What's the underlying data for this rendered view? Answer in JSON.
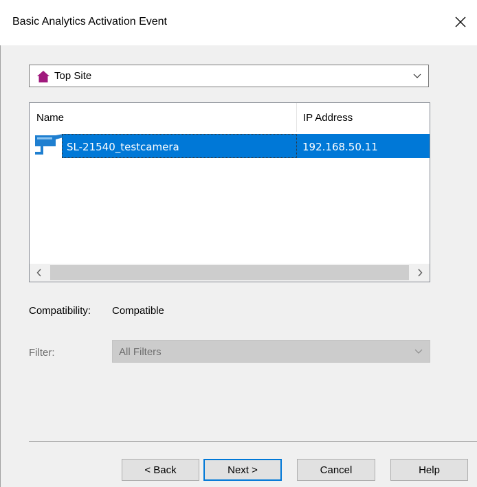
{
  "window": {
    "title": "Basic Analytics Activation Event",
    "close_icon": "close-icon"
  },
  "site_select": {
    "value": "Top Site",
    "icon": "home-icon",
    "icon_color": "#a01a7d"
  },
  "device_list": {
    "columns": [
      "Name",
      "IP Address"
    ],
    "rows": [
      {
        "name": "SL-21540_testcamera",
        "ip": "192.168.50.11",
        "icon": "camera-icon",
        "selected": true
      }
    ],
    "selection_color": "#0078d7"
  },
  "compatibility": {
    "label": "Compatibility:",
    "value": "Compatible"
  },
  "filter": {
    "label": "Filter:",
    "value": "All Filters",
    "enabled": false
  },
  "buttons": {
    "back": "< Back",
    "next": "Next >",
    "cancel": "Cancel",
    "help": "Help"
  }
}
